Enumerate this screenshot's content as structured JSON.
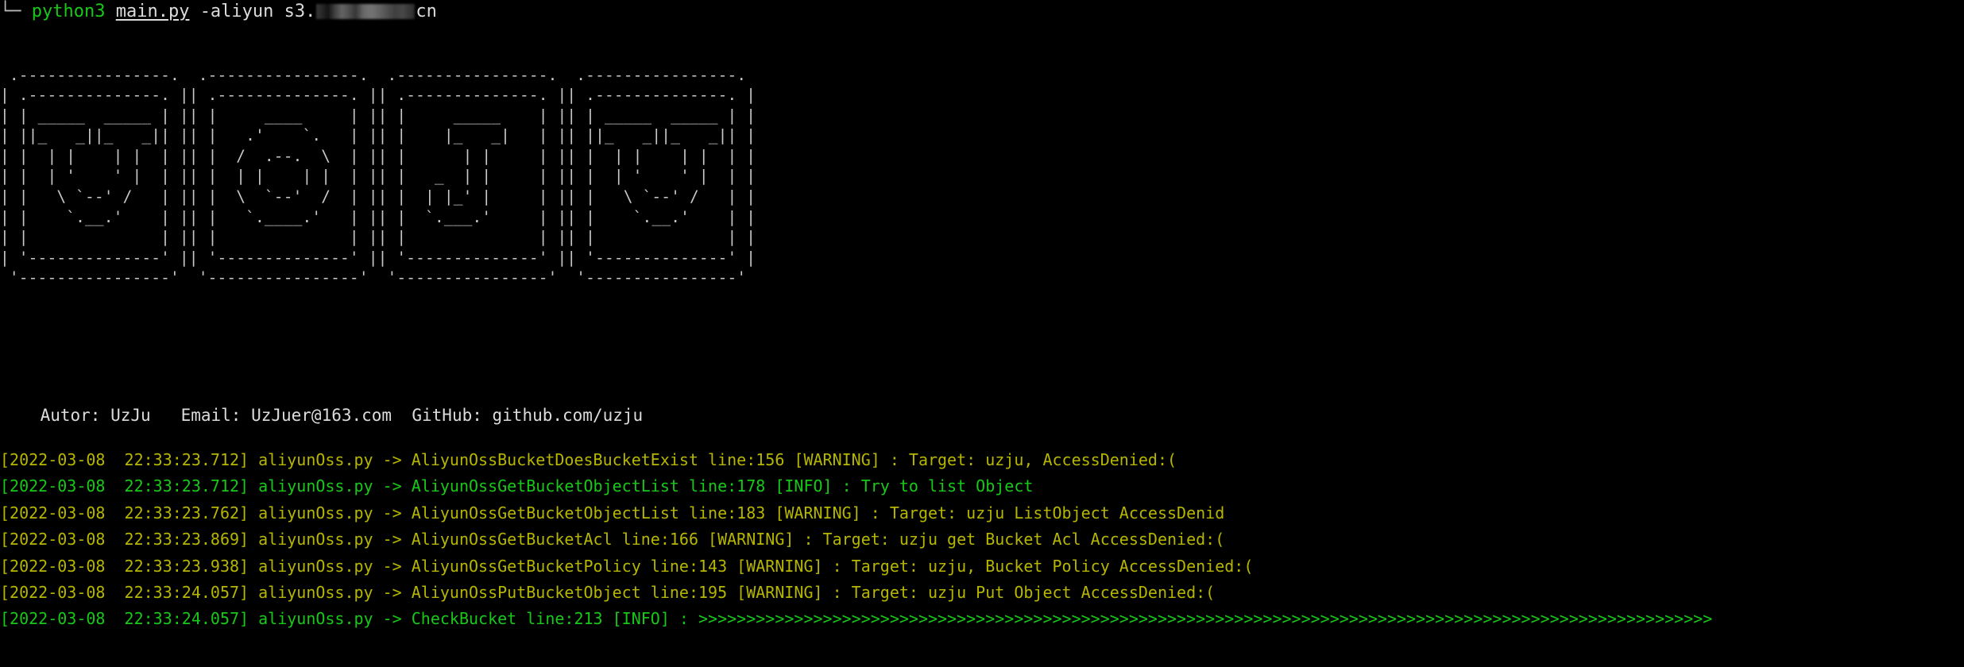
{
  "terminal": {
    "background_color": "#000000",
    "colors": {
      "green": "#18c818",
      "yellow": "#b6b600",
      "white": "#dcdcdc",
      "gray": "#b8b8b8"
    }
  },
  "prompt": {
    "corner_glyph": "└─",
    "command": "python3",
    "script": "main.py",
    "flag": "-aliyun",
    "target_prefix": "s3.",
    "target_suffix": "cn",
    "redacted_note": "redacted"
  },
  "banner": {
    "name": "UzJu",
    "art": [
      " .----------------.  .----------------.  .----------------.  .----------------. ",
      "| .--------------. || .--------------. || .--------------. || .--------------. |",
      "| | _____  _____ | || |     ____     | || |     _____    | || | _____  _____ | |",
      "| ||_   _||_   _|| || |   .'    `.   | || |    |_   _|   | || ||_   _||_   _|| |",
      "| |  | |    | |  | || |  /  .--.  \\  | || |      | |     | || |  | |    | |  | |",
      "| |  | '    ' |  | || |  | |    | |  | || |   _  | |     | || |  | '    ' |  | |",
      "| |   \\ `--' /   | || |  \\  `--'  /  | || |  | |_' |     | || |   \\ `--' /   | |",
      "| |    `.__.'    | || |   `.____.'   | || |  `.___.'     | || |    `.__.'    | |",
      "| |              | || |              | || |              | || |              | |",
      "| '--------------' || '--------------' || '--------------' || '--------------' |",
      " '----------------'  '----------------'  '----------------'  '----------------' "
    ]
  },
  "credits": {
    "line": "    Autor: UzJu   Email: UzJuer@163.com  GitHub: github.com/uzju",
    "author_label": "Autor:",
    "author": "UzJu",
    "email_label": "Email:",
    "email": "UzJuer@163.com",
    "github_label": "GitHub:",
    "github": "github.com/uzju"
  },
  "logs": [
    {
      "level": "WARNING",
      "color": "yellow",
      "text": "[2022-03-08  22:33:23.712] aliyunOss.py -> AliyunOssBucketDoesBucketExist line:156 [WARNING] : Target: uzju, AccessDenied:("
    },
    {
      "level": "INFO",
      "color": "green",
      "text": "[2022-03-08  22:33:23.712] aliyunOss.py -> AliyunOssGetBucketObjectList line:178 [INFO] : Try to list Object"
    },
    {
      "level": "WARNING",
      "color": "yellow",
      "text": "[2022-03-08  22:33:23.762] aliyunOss.py -> AliyunOssGetBucketObjectList line:183 [WARNING] : Target: uzju ListObject AccessDenid"
    },
    {
      "level": "WARNING",
      "color": "yellow",
      "text": "[2022-03-08  22:33:23.869] aliyunOss.py -> AliyunOssGetBucketAcl line:166 [WARNING] : Target: uzju get Bucket Acl AccessDenied:("
    },
    {
      "level": "WARNING",
      "color": "yellow",
      "text": "[2022-03-08  22:33:23.938] aliyunOss.py -> AliyunOssGetBucketPolicy line:143 [WARNING] : Target: uzju, Bucket Policy AccessDenied:("
    },
    {
      "level": "WARNING",
      "color": "yellow",
      "text": "[2022-03-08  22:33:24.057] aliyunOss.py -> AliyunOssPutBucketObject line:195 [WARNING] : Target: uzju Put Object AccessDenied:("
    },
    {
      "level": "INFO",
      "color": "green",
      "text": "[2022-03-08  22:33:24.057] aliyunOss.py -> CheckBucket line:213 [INFO] : >>>>>>>>>>>>>>>>>>>>>>>>>>>>>>>>>>>>>>>>>>>>>>>>>>>>>>>>>>>>>>>>>>>>>>>>>>>>>>>>>>>>>>>>>>>>>>>>>>>>>>>>>>"
    }
  ]
}
